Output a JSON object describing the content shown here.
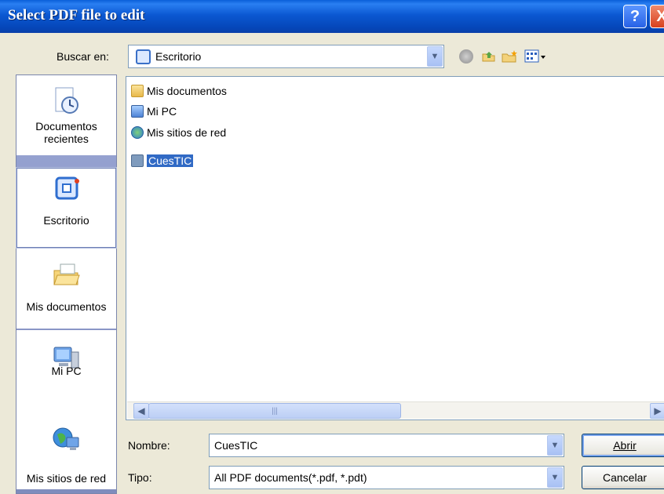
{
  "window": {
    "title": "Select PDF file to edit",
    "help_label": "?",
    "close_label": "X"
  },
  "toolbar": {
    "look_in_label": "Buscar en:",
    "look_in_value": "Escritorio",
    "buttons": [
      "back-icon",
      "up-folder-icon",
      "new-folder-icon",
      "views-menu-icon"
    ]
  },
  "places": [
    {
      "label": "Documentos recientes",
      "icon": "recent-documents-icon"
    },
    {
      "label": "Escritorio",
      "icon": "desktop-icon",
      "selected": true
    },
    {
      "label": "Mis documentos",
      "icon": "my-documents-icon"
    },
    {
      "label": "Mi PC",
      "icon": "my-computer-icon"
    },
    {
      "label": "Mis sitios de red",
      "icon": "network-places-icon"
    }
  ],
  "files": [
    {
      "name": "Mis documentos",
      "icon": "my-documents-icon"
    },
    {
      "name": "Mi PC",
      "icon": "my-computer-icon"
    },
    {
      "name": "Mis sitios de red",
      "icon": "network-places-icon"
    },
    {
      "name": "CuesTIC",
      "icon": "pdf-file-icon",
      "selected": true
    }
  ],
  "scrollbar": {
    "thumb_grip": "|||"
  },
  "filename": {
    "label": "Nombre:",
    "value": "CuesTIC"
  },
  "filetype": {
    "label": "Tipo:",
    "value": "All PDF documents(*.pdf, *.pdt)"
  },
  "buttons": {
    "open": "Abrir",
    "cancel": "Cancelar"
  },
  "colors": {
    "titlebar": "#0b58d2",
    "places_bar": "#8a97c6",
    "selection": "#316ac5",
    "dialog_bg": "#ece9d8"
  }
}
